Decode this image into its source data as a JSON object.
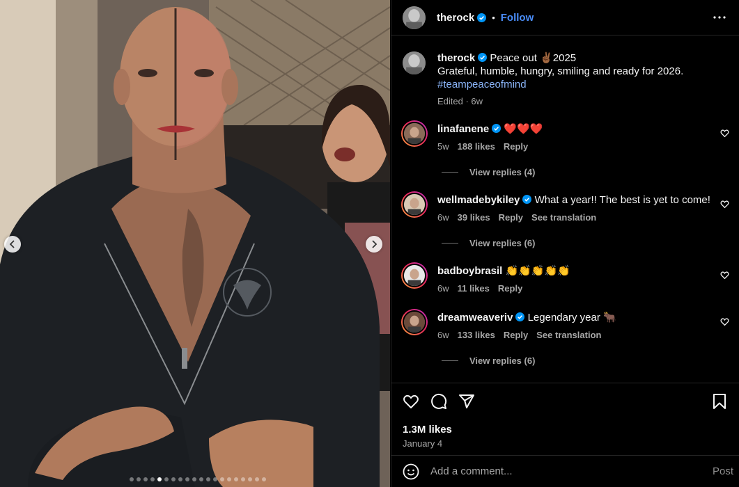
{
  "post": {
    "author": "therock",
    "follow_label": "Follow",
    "separator": "•",
    "caption_line1": "Peace out ✌🏾2025",
    "caption_line2": "Grateful, humble, hungry, smiling and ready for 2026.",
    "hashtag": "#teampeaceofmind",
    "caption_meta": "Edited · 6w",
    "likes": "1.3M likes",
    "date": "January 4",
    "carousel": {
      "total_slides": 20,
      "active_index": 4
    }
  },
  "comments": [
    {
      "user": "linafanene",
      "verified": true,
      "text": "❤️❤️❤️",
      "age": "5w",
      "likes": "188 likes",
      "reply": "Reply",
      "translation": "",
      "replies": "View replies (4)"
    },
    {
      "user": "wellmadebykiley",
      "verified": true,
      "text": "What a year!! The best is yet to come!",
      "age": "6w",
      "likes": "39 likes",
      "reply": "Reply",
      "translation": "See translation",
      "replies": "View replies (6)"
    },
    {
      "user": "badboybrasil",
      "verified": false,
      "text": "👏👏👏👏👏",
      "age": "6w",
      "likes": "11 likes",
      "reply": "Reply",
      "translation": "",
      "replies": ""
    },
    {
      "user": "dreamweaveriv",
      "verified": true,
      "text": "Legendary year 🐂",
      "age": "6w",
      "likes": "133 likes",
      "reply": "Reply",
      "translation": "See translation",
      "replies": "View replies (6)"
    }
  ],
  "composer": {
    "placeholder": "Add a comment...",
    "post_label": "Post"
  },
  "icons": [
    "heart-icon",
    "comment-icon",
    "share-icon",
    "bookmark-icon",
    "emoji-icon",
    "more-icon",
    "verified-icon",
    "chevron-left-icon",
    "chevron-right-icon"
  ],
  "colors": {
    "link": "#4a8df8",
    "hashtag": "#8ab4f8",
    "background": "#000000",
    "muted": "#a8a8a8",
    "verified": "#0095f6"
  }
}
